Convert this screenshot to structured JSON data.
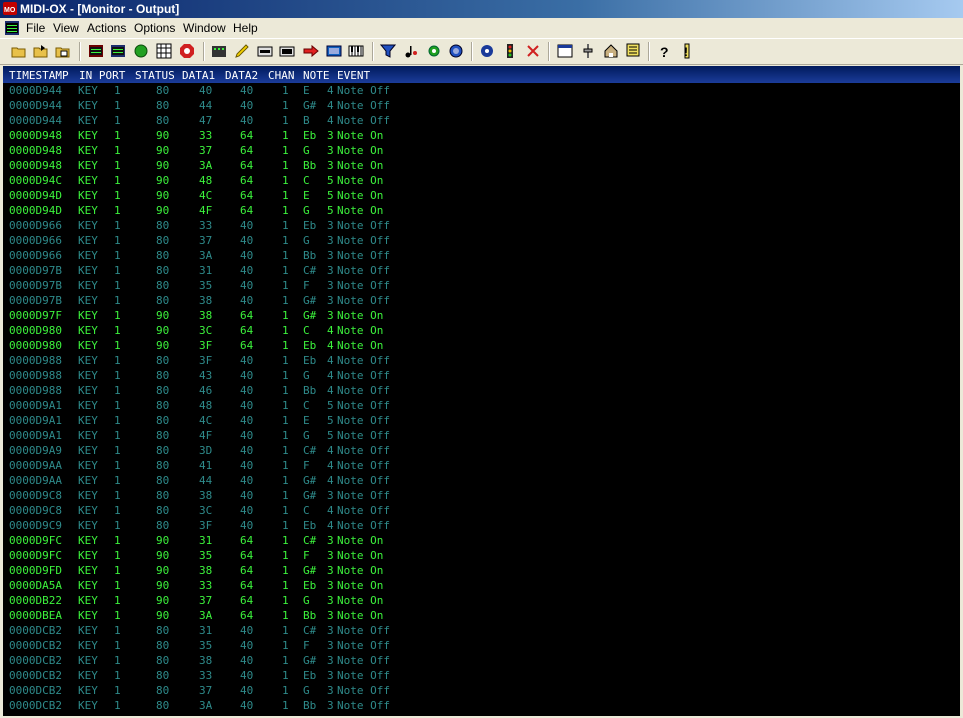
{
  "window": {
    "title": "MIDI-OX - [Monitor - Output]"
  },
  "menu": [
    "File",
    "View",
    "Actions",
    "Options",
    "Window",
    "Help"
  ],
  "toolbar": {
    "buttons": [
      "open-icon",
      "save-icon",
      "save-as-icon",
      "input-monitor-icon",
      "output-monitor-icon",
      "green-dot-icon",
      "grid-icon",
      "stop-sign-icon",
      "keyboard-icon",
      "pen-icon",
      "port-in-icon",
      "port-out-icon",
      "red-arrow-icon",
      "control-panel-icon",
      "piano-icon",
      "filter-icon",
      "notes-icon",
      "gear-icon",
      "midi-plug-icon",
      "sysex-icon",
      "traffic-light-icon",
      "x-icon",
      "window-icon",
      "slider-icon",
      "house-icon",
      "config-icon",
      "help-icon",
      "exclaim-icon"
    ]
  },
  "monitor": {
    "headers": {
      "timestamp": "TIMESTAMP",
      "in_port": "IN PORT",
      "status": "STATUS",
      "data1": "DATA1",
      "data2": "DATA2",
      "chan": "CHAN",
      "note": "NOTE",
      "event": "EVENT"
    },
    "rows": [
      {
        "ts": "0000D944",
        "port": "KEY",
        "in": "1",
        "status": "80",
        "d1": "40",
        "d2": "40",
        "chan": "1",
        "note": "E",
        "oct": "4",
        "event": "Note Off",
        "on": false
      },
      {
        "ts": "0000D944",
        "port": "KEY",
        "in": "1",
        "status": "80",
        "d1": "44",
        "d2": "40",
        "chan": "1",
        "note": "G#",
        "oct": "4",
        "event": "Note Off",
        "on": false
      },
      {
        "ts": "0000D944",
        "port": "KEY",
        "in": "1",
        "status": "80",
        "d1": "47",
        "d2": "40",
        "chan": "1",
        "note": "B",
        "oct": "4",
        "event": "Note Off",
        "on": false
      },
      {
        "ts": "0000D948",
        "port": "KEY",
        "in": "1",
        "status": "90",
        "d1": "33",
        "d2": "64",
        "chan": "1",
        "note": "Eb",
        "oct": "3",
        "event": "Note On",
        "on": true
      },
      {
        "ts": "0000D948",
        "port": "KEY",
        "in": "1",
        "status": "90",
        "d1": "37",
        "d2": "64",
        "chan": "1",
        "note": "G",
        "oct": "3",
        "event": "Note On",
        "on": true
      },
      {
        "ts": "0000D948",
        "port": "KEY",
        "in": "1",
        "status": "90",
        "d1": "3A",
        "d2": "64",
        "chan": "1",
        "note": "Bb",
        "oct": "3",
        "event": "Note On",
        "on": true
      },
      {
        "ts": "0000D94C",
        "port": "KEY",
        "in": "1",
        "status": "90",
        "d1": "48",
        "d2": "64",
        "chan": "1",
        "note": "C",
        "oct": "5",
        "event": "Note On",
        "on": true
      },
      {
        "ts": "0000D94D",
        "port": "KEY",
        "in": "1",
        "status": "90",
        "d1": "4C",
        "d2": "64",
        "chan": "1",
        "note": "E",
        "oct": "5",
        "event": "Note On",
        "on": true
      },
      {
        "ts": "0000D94D",
        "port": "KEY",
        "in": "1",
        "status": "90",
        "d1": "4F",
        "d2": "64",
        "chan": "1",
        "note": "G",
        "oct": "5",
        "event": "Note On",
        "on": true
      },
      {
        "ts": "0000D966",
        "port": "KEY",
        "in": "1",
        "status": "80",
        "d1": "33",
        "d2": "40",
        "chan": "1",
        "note": "Eb",
        "oct": "3",
        "event": "Note Off",
        "on": false
      },
      {
        "ts": "0000D966",
        "port": "KEY",
        "in": "1",
        "status": "80",
        "d1": "37",
        "d2": "40",
        "chan": "1",
        "note": "G",
        "oct": "3",
        "event": "Note Off",
        "on": false
      },
      {
        "ts": "0000D966",
        "port": "KEY",
        "in": "1",
        "status": "80",
        "d1": "3A",
        "d2": "40",
        "chan": "1",
        "note": "Bb",
        "oct": "3",
        "event": "Note Off",
        "on": false
      },
      {
        "ts": "0000D97B",
        "port": "KEY",
        "in": "1",
        "status": "80",
        "d1": "31",
        "d2": "40",
        "chan": "1",
        "note": "C#",
        "oct": "3",
        "event": "Note Off",
        "on": false
      },
      {
        "ts": "0000D97B",
        "port": "KEY",
        "in": "1",
        "status": "80",
        "d1": "35",
        "d2": "40",
        "chan": "1",
        "note": "F",
        "oct": "3",
        "event": "Note Off",
        "on": false
      },
      {
        "ts": "0000D97B",
        "port": "KEY",
        "in": "1",
        "status": "80",
        "d1": "38",
        "d2": "40",
        "chan": "1",
        "note": "G#",
        "oct": "3",
        "event": "Note Off",
        "on": false
      },
      {
        "ts": "0000D97F",
        "port": "KEY",
        "in": "1",
        "status": "90",
        "d1": "38",
        "d2": "64",
        "chan": "1",
        "note": "G#",
        "oct": "3",
        "event": "Note On",
        "on": true
      },
      {
        "ts": "0000D980",
        "port": "KEY",
        "in": "1",
        "status": "90",
        "d1": "3C",
        "d2": "64",
        "chan": "1",
        "note": "C",
        "oct": "4",
        "event": "Note On",
        "on": true
      },
      {
        "ts": "0000D980",
        "port": "KEY",
        "in": "1",
        "status": "90",
        "d1": "3F",
        "d2": "64",
        "chan": "1",
        "note": "Eb",
        "oct": "4",
        "event": "Note On",
        "on": true
      },
      {
        "ts": "0000D988",
        "port": "KEY",
        "in": "1",
        "status": "80",
        "d1": "3F",
        "d2": "40",
        "chan": "1",
        "note": "Eb",
        "oct": "4",
        "event": "Note Off",
        "on": false
      },
      {
        "ts": "0000D988",
        "port": "KEY",
        "in": "1",
        "status": "80",
        "d1": "43",
        "d2": "40",
        "chan": "1",
        "note": "G",
        "oct": "4",
        "event": "Note Off",
        "on": false
      },
      {
        "ts": "0000D988",
        "port": "KEY",
        "in": "1",
        "status": "80",
        "d1": "46",
        "d2": "40",
        "chan": "1",
        "note": "Bb",
        "oct": "4",
        "event": "Note Off",
        "on": false
      },
      {
        "ts": "0000D9A1",
        "port": "KEY",
        "in": "1",
        "status": "80",
        "d1": "48",
        "d2": "40",
        "chan": "1",
        "note": "C",
        "oct": "5",
        "event": "Note Off",
        "on": false
      },
      {
        "ts": "0000D9A1",
        "port": "KEY",
        "in": "1",
        "status": "80",
        "d1": "4C",
        "d2": "40",
        "chan": "1",
        "note": "E",
        "oct": "5",
        "event": "Note Off",
        "on": false
      },
      {
        "ts": "0000D9A1",
        "port": "KEY",
        "in": "1",
        "status": "80",
        "d1": "4F",
        "d2": "40",
        "chan": "1",
        "note": "G",
        "oct": "5",
        "event": "Note Off",
        "on": false
      },
      {
        "ts": "0000D9A9",
        "port": "KEY",
        "in": "1",
        "status": "80",
        "d1": "3D",
        "d2": "40",
        "chan": "1",
        "note": "C#",
        "oct": "4",
        "event": "Note Off",
        "on": false
      },
      {
        "ts": "0000D9AA",
        "port": "KEY",
        "in": "1",
        "status": "80",
        "d1": "41",
        "d2": "40",
        "chan": "1",
        "note": "F",
        "oct": "4",
        "event": "Note Off",
        "on": false
      },
      {
        "ts": "0000D9AA",
        "port": "KEY",
        "in": "1",
        "status": "80",
        "d1": "44",
        "d2": "40",
        "chan": "1",
        "note": "G#",
        "oct": "4",
        "event": "Note Off",
        "on": false
      },
      {
        "ts": "0000D9C8",
        "port": "KEY",
        "in": "1",
        "status": "80",
        "d1": "38",
        "d2": "40",
        "chan": "1",
        "note": "G#",
        "oct": "3",
        "event": "Note Off",
        "on": false
      },
      {
        "ts": "0000D9C8",
        "port": "KEY",
        "in": "1",
        "status": "80",
        "d1": "3C",
        "d2": "40",
        "chan": "1",
        "note": "C",
        "oct": "4",
        "event": "Note Off",
        "on": false
      },
      {
        "ts": "0000D9C9",
        "port": "KEY",
        "in": "1",
        "status": "80",
        "d1": "3F",
        "d2": "40",
        "chan": "1",
        "note": "Eb",
        "oct": "4",
        "event": "Note Off",
        "on": false
      },
      {
        "ts": "0000D9FC",
        "port": "KEY",
        "in": "1",
        "status": "90",
        "d1": "31",
        "d2": "64",
        "chan": "1",
        "note": "C#",
        "oct": "3",
        "event": "Note On",
        "on": true
      },
      {
        "ts": "0000D9FC",
        "port": "KEY",
        "in": "1",
        "status": "90",
        "d1": "35",
        "d2": "64",
        "chan": "1",
        "note": "F",
        "oct": "3",
        "event": "Note On",
        "on": true
      },
      {
        "ts": "0000D9FD",
        "port": "KEY",
        "in": "1",
        "status": "90",
        "d1": "38",
        "d2": "64",
        "chan": "1",
        "note": "G#",
        "oct": "3",
        "event": "Note On",
        "on": true
      },
      {
        "ts": "0000DA5A",
        "port": "KEY",
        "in": "1",
        "status": "90",
        "d1": "33",
        "d2": "64",
        "chan": "1",
        "note": "Eb",
        "oct": "3",
        "event": "Note On",
        "on": true
      },
      {
        "ts": "0000DB22",
        "port": "KEY",
        "in": "1",
        "status": "90",
        "d1": "37",
        "d2": "64",
        "chan": "1",
        "note": "G",
        "oct": "3",
        "event": "Note On",
        "on": true
      },
      {
        "ts": "0000DBEA",
        "port": "KEY",
        "in": "1",
        "status": "90",
        "d1": "3A",
        "d2": "64",
        "chan": "1",
        "note": "Bb",
        "oct": "3",
        "event": "Note On",
        "on": true
      },
      {
        "ts": "0000DCB2",
        "port": "KEY",
        "in": "1",
        "status": "80",
        "d1": "31",
        "d2": "40",
        "chan": "1",
        "note": "C#",
        "oct": "3",
        "event": "Note Off",
        "on": false
      },
      {
        "ts": "0000DCB2",
        "port": "KEY",
        "in": "1",
        "status": "80",
        "d1": "35",
        "d2": "40",
        "chan": "1",
        "note": "F",
        "oct": "3",
        "event": "Note Off",
        "on": false
      },
      {
        "ts": "0000DCB2",
        "port": "KEY",
        "in": "1",
        "status": "80",
        "d1": "38",
        "d2": "40",
        "chan": "1",
        "note": "G#",
        "oct": "3",
        "event": "Note Off",
        "on": false
      },
      {
        "ts": "0000DCB2",
        "port": "KEY",
        "in": "1",
        "status": "80",
        "d1": "33",
        "d2": "40",
        "chan": "1",
        "note": "Eb",
        "oct": "3",
        "event": "Note Off",
        "on": false
      },
      {
        "ts": "0000DCB2",
        "port": "KEY",
        "in": "1",
        "status": "80",
        "d1": "37",
        "d2": "40",
        "chan": "1",
        "note": "G",
        "oct": "3",
        "event": "Note Off",
        "on": false
      },
      {
        "ts": "0000DCB2",
        "port": "KEY",
        "in": "1",
        "status": "80",
        "d1": "3A",
        "d2": "40",
        "chan": "1",
        "note": "Bb",
        "oct": "3",
        "event": "Note Off",
        "on": false
      }
    ]
  },
  "colors": {
    "note_off": "#2e8a8a",
    "note_on": "#3cf23c",
    "background": "#000000",
    "header": "#0a246a"
  }
}
